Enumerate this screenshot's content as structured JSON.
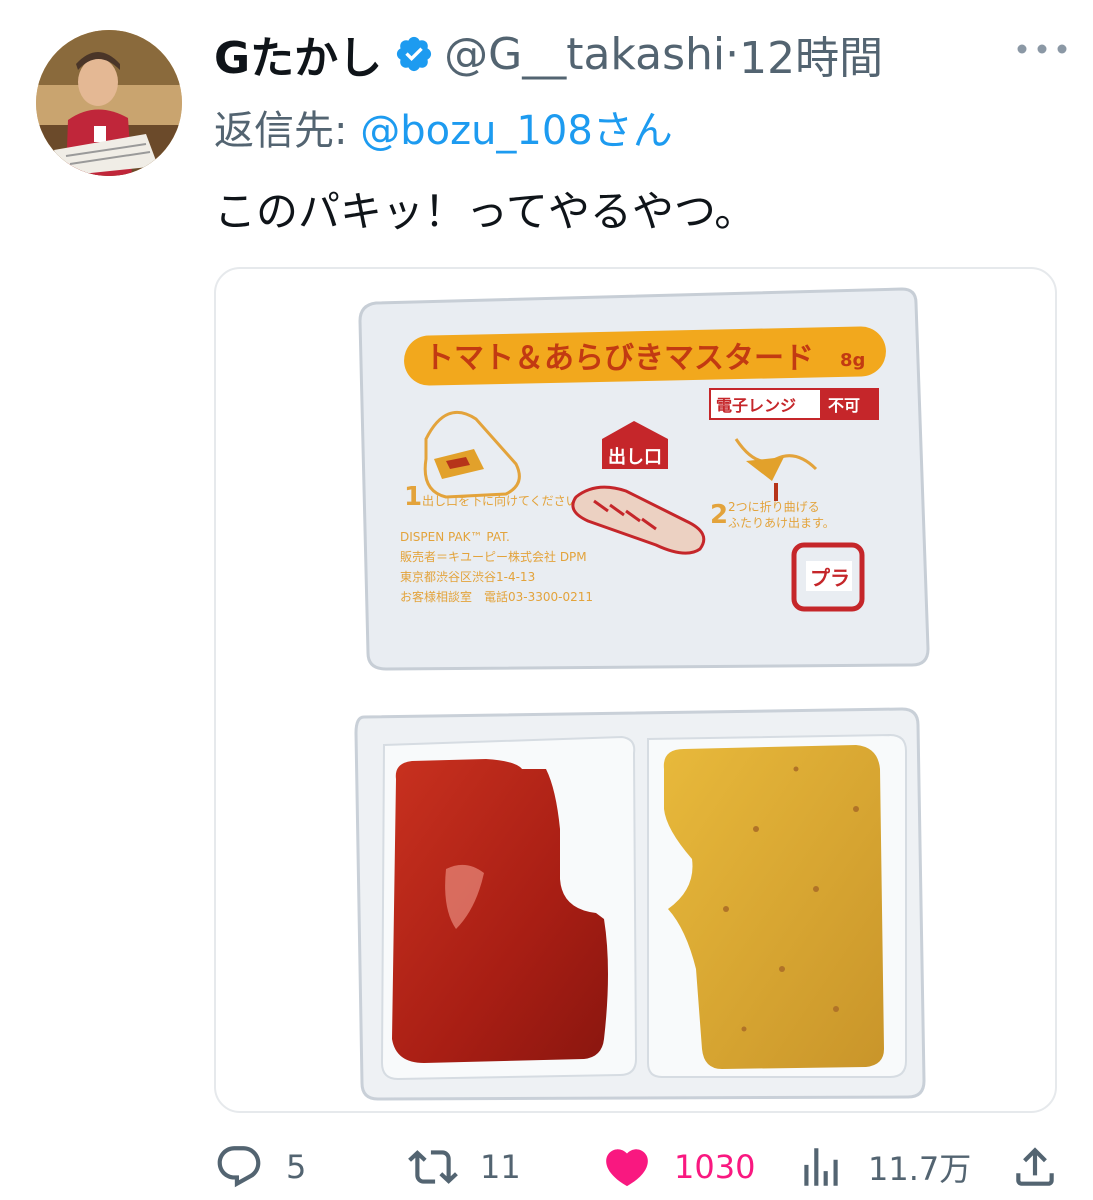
{
  "tweet": {
    "display_name": "Gたかし",
    "handle": "@G__takashi",
    "separator": "·",
    "time": "12時間",
    "reply_prefix": "返信先: ",
    "reply_mention": "@bozu_108さん",
    "text": "このパキッ！ってやるやつ。"
  },
  "media": {
    "package_label": "トマト＆あらびきマスタード",
    "package_weight": "8g",
    "microwave_label": "電子レンジ",
    "microwave_no": "不可",
    "outlet_label": "出し口",
    "step1": "出し口を下に向けてください。",
    "step2_a": "2つに折り曲げる",
    "step2_b": "ふたりあけ出ます。",
    "brand_line1": "DISPEN PAK™ PAT.",
    "brand_line2": "販売者＝キユーピー株式会社 DPM",
    "brand_line3": "東京都渋谷区渋谷1-4-13",
    "brand_line4": "お客様相談室　電話03-3300-0211",
    "recycle_mark": "プラ"
  },
  "actions": {
    "replies": "5",
    "retweets": "11",
    "likes": "1030",
    "views": "11.7万"
  },
  "colors": {
    "accent": "#1d9bf0",
    "like": "#f91880",
    "secondary": "#536471"
  }
}
